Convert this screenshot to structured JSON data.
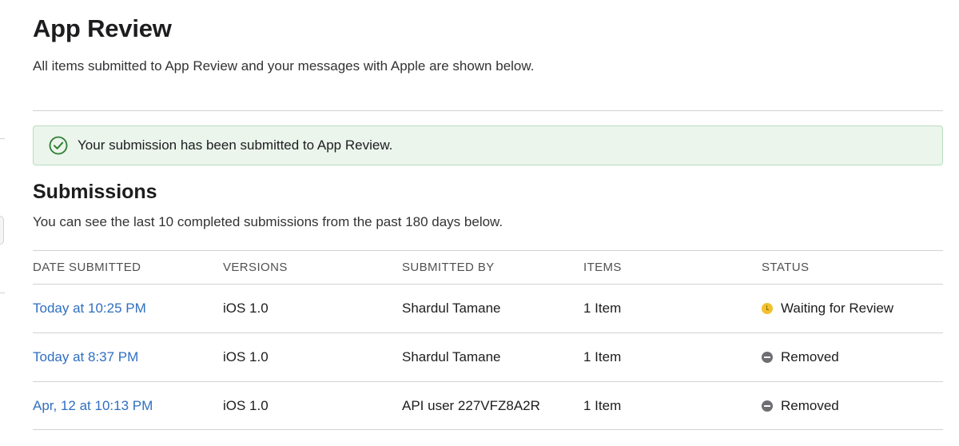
{
  "header": {
    "title": "App Review",
    "subtitle": "All items submitted to App Review and your messages with Apple are shown below."
  },
  "banner": {
    "message": "Your submission has been submitted to App Review.",
    "icon": "check-circle-icon",
    "color": "#2e7d32"
  },
  "submissions": {
    "title": "Submissions",
    "subtitle": "You can see the last 10 completed submissions from the past 180 days below.",
    "columns": [
      "DATE SUBMITTED",
      "VERSIONS",
      "SUBMITTED BY",
      "ITEMS",
      "STATUS"
    ],
    "rows": [
      {
        "date": "Today at 10:25 PM",
        "version": "iOS 1.0",
        "submitted_by": "Shardul Tamane",
        "items": "1 Item",
        "status": "Waiting for Review",
        "status_color": "#f2c12e"
      },
      {
        "date": "Today at 8:37 PM",
        "version": "iOS 1.0",
        "submitted_by": "Shardul Tamane",
        "items": "1 Item",
        "status": "Removed",
        "status_color": "#6e6e73"
      },
      {
        "date": "Apr, 12 at 10:13 PM",
        "version": "iOS 1.0",
        "submitted_by": "API user 227VFZ8A2R",
        "items": "1 Item",
        "status": "Removed",
        "status_color": "#6e6e73"
      }
    ]
  },
  "colors": {
    "link": "#2f6fc1",
    "banner_background": "#ebf5ec",
    "divider": "#d2d2d7"
  }
}
